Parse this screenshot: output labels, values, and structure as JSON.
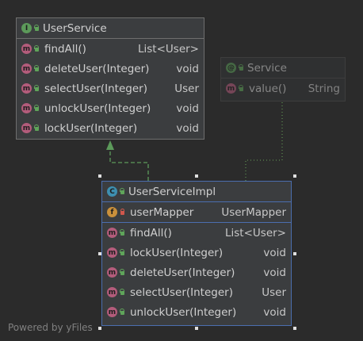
{
  "interface_box": {
    "badge": "I",
    "title": "UserService",
    "methods": [
      {
        "badge": "m",
        "name": "findAll()",
        "type": "List<User>"
      },
      {
        "badge": "m",
        "name": "deleteUser(Integer)",
        "type": "void"
      },
      {
        "badge": "m",
        "name": "selectUser(Integer)",
        "type": "User"
      },
      {
        "badge": "m",
        "name": "unlockUser(Integer)",
        "type": "void"
      },
      {
        "badge": "m",
        "name": "lockUser(Integer)",
        "type": "void"
      }
    ]
  },
  "annotation_box": {
    "badge": "@",
    "title": "Service",
    "methods": [
      {
        "badge": "m",
        "name": "value()",
        "type": "String"
      }
    ]
  },
  "class_box": {
    "badge": "C",
    "title": "UserServiceImpl",
    "fields": [
      {
        "badge": "f",
        "name": "userMapper",
        "type": "UserMapper"
      }
    ],
    "methods": [
      {
        "badge": "m",
        "name": "findAll()",
        "type": "List<User>"
      },
      {
        "badge": "m",
        "name": "lockUser(Integer)",
        "type": "void"
      },
      {
        "badge": "m",
        "name": "deleteUser(Integer)",
        "type": "void"
      },
      {
        "badge": "m",
        "name": "selectUser(Integer)",
        "type": "User"
      },
      {
        "badge": "m",
        "name": "unlockUser(Integer)",
        "type": "void"
      }
    ]
  },
  "watermark": "Powered by yFiles",
  "colors": {
    "background": "#2b2b2b",
    "node_fill": "#3b3d3f",
    "selection": "#4b6eaf",
    "implements_edge": "#5c9a5a",
    "annotation_edge": "#6a9a5a"
  }
}
